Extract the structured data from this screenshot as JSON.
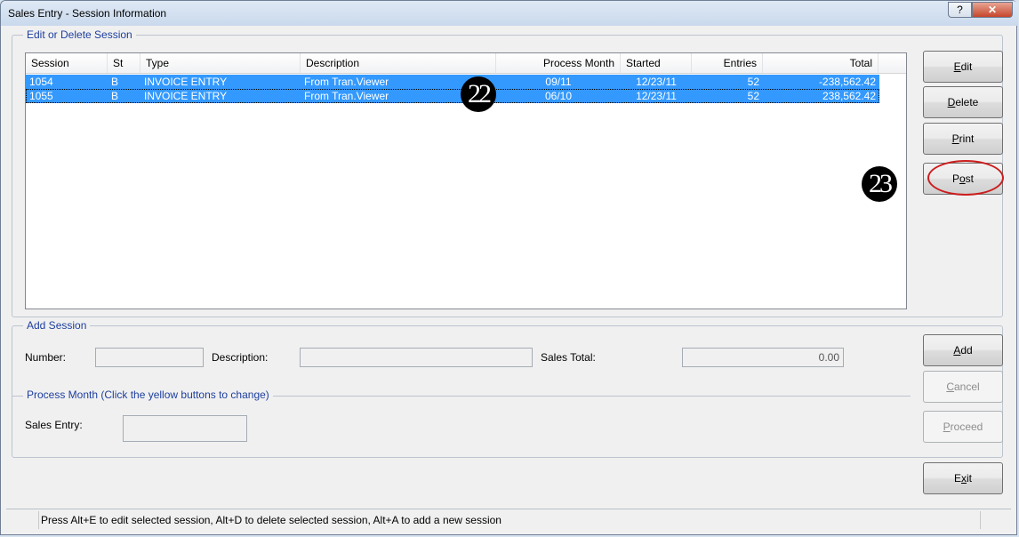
{
  "window": {
    "title": "Sales Entry - Session Information",
    "help_label": "?",
    "close_label": "✕"
  },
  "edit_group": {
    "legend": "Edit or Delete Session",
    "columns": [
      "Session",
      "St",
      "Type",
      "Description",
      "Process Month",
      "Started",
      "Entries",
      "Total"
    ],
    "rows": [
      {
        "session": "1054",
        "st": "B",
        "type": "INVOICE ENTRY",
        "description": "From Tran.Viewer",
        "process_month": "09/11",
        "started": "12/23/11",
        "entries": "52",
        "total": "-238,562.42"
      },
      {
        "session": "1055",
        "st": "B",
        "type": "INVOICE ENTRY",
        "description": "From Tran.Viewer",
        "process_month": "06/10",
        "started": "12/23/11",
        "entries": "52",
        "total": "238,562.42"
      }
    ]
  },
  "side_buttons": {
    "edit": {
      "pre": "",
      "key": "E",
      "post": "dit"
    },
    "delete": {
      "pre": "",
      "key": "D",
      "post": "elete"
    },
    "print": {
      "pre": "",
      "key": "P",
      "post": "rint"
    },
    "post": {
      "pre": "P",
      "key": "o",
      "post": "st"
    },
    "add": {
      "pre": "",
      "key": "A",
      "post": "dd"
    },
    "cancel": {
      "pre": "",
      "key": "C",
      "post": "ancel"
    },
    "proceed": {
      "pre": "",
      "key": "P",
      "post": "roceed"
    },
    "exit": {
      "pre": "E",
      "key": "x",
      "post": "it"
    }
  },
  "add_group": {
    "legend": "Add Session",
    "number_label": "Number:",
    "number_value": "",
    "description_label": "Description:",
    "description_value": "",
    "sales_total_label": "Sales Total:",
    "sales_total_value": "0.00"
  },
  "process_group": {
    "legend": "Process Month (Click the yellow buttons to change)",
    "sales_entry_label": "Sales Entry:",
    "sales_entry_value": ""
  },
  "annotations": {
    "badge_1": "22",
    "badge_2": "23"
  },
  "status": {
    "text": "Press Alt+E to edit selected session, Alt+D to delete selected session, Alt+A to add a new session"
  },
  "colors": {
    "selection": "#3399ff",
    "legend_text": "#1e3f9e",
    "annotation_ring": "#cc1d1d"
  }
}
